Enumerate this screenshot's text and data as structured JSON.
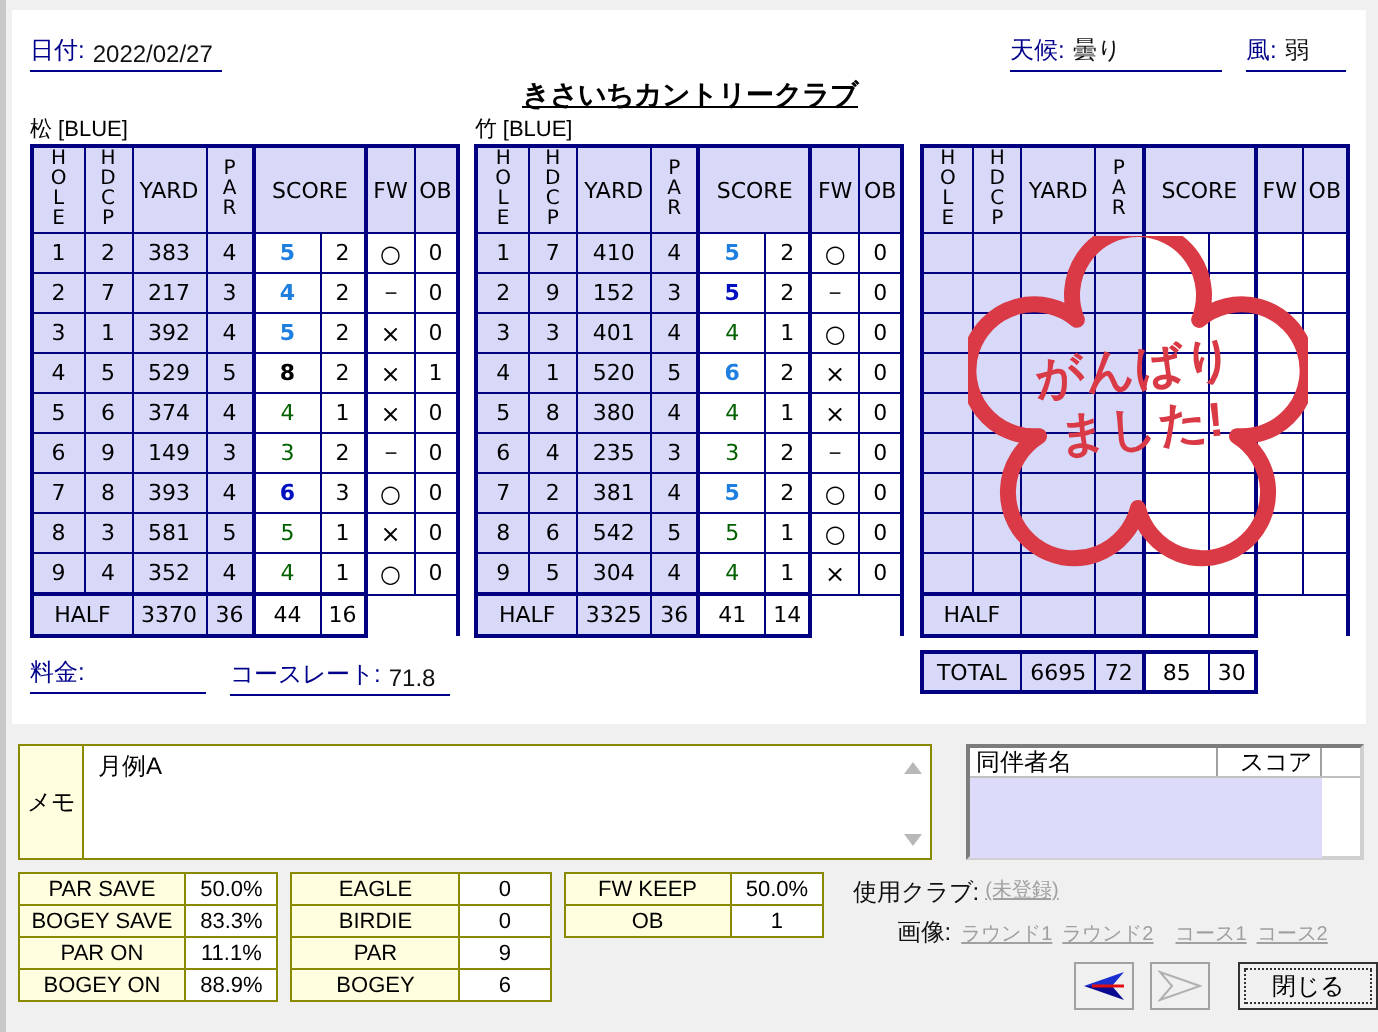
{
  "header": {
    "date_label": "日付:",
    "date": "2022/02/27",
    "weather_label": "天候:",
    "weather": "曇り",
    "wind_label": "風:",
    "wind": "弱"
  },
  "title": "きさいちカントリークラブ",
  "courses": [
    {
      "name": "松 [BLUE]",
      "columns": [
        {
          "label": "HOLE",
          "vertical": true
        },
        {
          "label": "HDCP",
          "vertical": true
        },
        {
          "label": "YARD",
          "vertical": false
        },
        {
          "label": "PAR",
          "vertical": true
        },
        {
          "label": "SCORE",
          "vertical": false
        },
        {
          "label": "FW",
          "vertical": false
        },
        {
          "label": "OB",
          "vertical": false
        }
      ],
      "rows": [
        {
          "hole": "1",
          "hdcp": "2",
          "yard": "383",
          "par": "4",
          "score": {
            "value": "5",
            "color": "#1e7fe0",
            "bold": true
          },
          "putts": "2",
          "fw": "○",
          "ob": "0"
        },
        {
          "hole": "2",
          "hdcp": "7",
          "yard": "217",
          "par": "3",
          "score": {
            "value": "4",
            "color": "#1e7fe0",
            "bold": true
          },
          "putts": "2",
          "fw": "－",
          "ob": "0"
        },
        {
          "hole": "3",
          "hdcp": "1",
          "yard": "392",
          "par": "4",
          "score": {
            "value": "5",
            "color": "#1e7fe0",
            "bold": true
          },
          "putts": "2",
          "fw": "×",
          "ob": "0"
        },
        {
          "hole": "4",
          "hdcp": "5",
          "yard": "529",
          "par": "5",
          "score": {
            "value": "8",
            "color": "#000000",
            "bold": true
          },
          "putts": "2",
          "fw": "×",
          "ob": "1"
        },
        {
          "hole": "5",
          "hdcp": "6",
          "yard": "374",
          "par": "4",
          "score": {
            "value": "4",
            "color": "#006000",
            "bold": false
          },
          "putts": "1",
          "fw": "×",
          "ob": "0"
        },
        {
          "hole": "6",
          "hdcp": "9",
          "yard": "149",
          "par": "3",
          "score": {
            "value": "3",
            "color": "#006000",
            "bold": false
          },
          "putts": "2",
          "fw": "－",
          "ob": "0"
        },
        {
          "hole": "7",
          "hdcp": "8",
          "yard": "393",
          "par": "4",
          "score": {
            "value": "6",
            "color": "#0010c0",
            "bold": true
          },
          "putts": "3",
          "fw": "○",
          "ob": "0"
        },
        {
          "hole": "8",
          "hdcp": "3",
          "yard": "581",
          "par": "5",
          "score": {
            "value": "5",
            "color": "#006000",
            "bold": false
          },
          "putts": "1",
          "fw": "×",
          "ob": "0"
        },
        {
          "hole": "9",
          "hdcp": "4",
          "yard": "352",
          "par": "4",
          "score": {
            "value": "4",
            "color": "#006000",
            "bold": false
          },
          "putts": "1",
          "fw": "○",
          "ob": "0"
        }
      ],
      "half": {
        "label": "HALF",
        "yard": "3370",
        "par": "36",
        "score": "44",
        "putts": "16"
      }
    },
    {
      "name": "竹 [BLUE]",
      "columns": [
        {
          "label": "HOLE",
          "vertical": true
        },
        {
          "label": "HDCP",
          "vertical": true
        },
        {
          "label": "YARD",
          "vertical": false
        },
        {
          "label": "PAR",
          "vertical": true
        },
        {
          "label": "SCORE",
          "vertical": false
        },
        {
          "label": "FW",
          "vertical": false
        },
        {
          "label": "OB",
          "vertical": false
        }
      ],
      "rows": [
        {
          "hole": "1",
          "hdcp": "7",
          "yard": "410",
          "par": "4",
          "score": {
            "value": "5",
            "color": "#1e7fe0",
            "bold": true
          },
          "putts": "2",
          "fw": "○",
          "ob": "0"
        },
        {
          "hole": "2",
          "hdcp": "9",
          "yard": "152",
          "par": "3",
          "score": {
            "value": "5",
            "color": "#0010c0",
            "bold": true
          },
          "putts": "2",
          "fw": "－",
          "ob": "0"
        },
        {
          "hole": "3",
          "hdcp": "3",
          "yard": "401",
          "par": "4",
          "score": {
            "value": "4",
            "color": "#006000",
            "bold": false
          },
          "putts": "1",
          "fw": "○",
          "ob": "0"
        },
        {
          "hole": "4",
          "hdcp": "1",
          "yard": "520",
          "par": "5",
          "score": {
            "value": "6",
            "color": "#1e7fe0",
            "bold": true
          },
          "putts": "2",
          "fw": "×",
          "ob": "0"
        },
        {
          "hole": "5",
          "hdcp": "8",
          "yard": "380",
          "par": "4",
          "score": {
            "value": "4",
            "color": "#006000",
            "bold": false
          },
          "putts": "1",
          "fw": "×",
          "ob": "0"
        },
        {
          "hole": "6",
          "hdcp": "4",
          "yard": "235",
          "par": "3",
          "score": {
            "value": "3",
            "color": "#006000",
            "bold": false
          },
          "putts": "2",
          "fw": "－",
          "ob": "0"
        },
        {
          "hole": "7",
          "hdcp": "2",
          "yard": "381",
          "par": "4",
          "score": {
            "value": "5",
            "color": "#1e7fe0",
            "bold": true
          },
          "putts": "2",
          "fw": "○",
          "ob": "0"
        },
        {
          "hole": "8",
          "hdcp": "6",
          "yard": "542",
          "par": "5",
          "score": {
            "value": "5",
            "color": "#006000",
            "bold": false
          },
          "putts": "1",
          "fw": "○",
          "ob": "0"
        },
        {
          "hole": "9",
          "hdcp": "5",
          "yard": "304",
          "par": "4",
          "score": {
            "value": "4",
            "color": "#006000",
            "bold": false
          },
          "putts": "1",
          "fw": "×",
          "ob": "0"
        }
      ],
      "half": {
        "label": "HALF",
        "yard": "3325",
        "par": "36",
        "score": "41",
        "putts": "14"
      }
    },
    {
      "columns": [
        {
          "label": "HOLE",
          "vertical": true
        },
        {
          "label": "HDCP",
          "vertical": true
        },
        {
          "label": "YARD",
          "vertical": false
        },
        {
          "label": "PAR",
          "vertical": true
        },
        {
          "label": "SCORE",
          "vertical": false
        },
        {
          "label": "FW",
          "vertical": false
        },
        {
          "label": "OB",
          "vertical": false
        }
      ],
      "half": {
        "label": "HALF"
      },
      "stamp": {
        "lines": [
          "がんばり",
          "ました!"
        ]
      }
    }
  ],
  "total": {
    "label": "TOTAL",
    "yard": "6695",
    "par": "72",
    "score": "85",
    "putts": "30"
  },
  "fee": {
    "label": "料金:"
  },
  "course_rate": {
    "label": "コースレート:",
    "value": "71.8"
  },
  "memo": {
    "label": "メモ",
    "value": "月例A"
  },
  "companions": {
    "columns": [
      "同伴者名",
      "スコア"
    ]
  },
  "stats": [
    [
      {
        "label": "PAR SAVE",
        "value": "50.0%"
      },
      {
        "label": "BOGEY SAVE",
        "value": "83.3%"
      },
      {
        "label": "PAR ON",
        "value": "11.1%"
      },
      {
        "label": "BOGEY ON",
        "value": "88.9%"
      }
    ],
    [
      {
        "label": "EAGLE",
        "value": "0"
      },
      {
        "label": "BIRDIE",
        "value": "0"
      },
      {
        "label": "PAR",
        "value": "9"
      },
      {
        "label": "BOGEY",
        "value": "6"
      }
    ],
    [
      {
        "label": "FW KEEP",
        "value": "50.0%"
      },
      {
        "label": "OB",
        "value": "1"
      }
    ]
  ],
  "club": {
    "label": "使用クラブ:",
    "value": "(未登録)"
  },
  "images": {
    "label": "画像:",
    "links": [
      "ラウンド1",
      "ラウンド2",
      "コース1",
      "コース2"
    ]
  },
  "nav_buttons": [
    {
      "kind": "prev",
      "disabled": false
    },
    {
      "kind": "next",
      "disabled": true
    }
  ],
  "close_button": "閉じる"
}
